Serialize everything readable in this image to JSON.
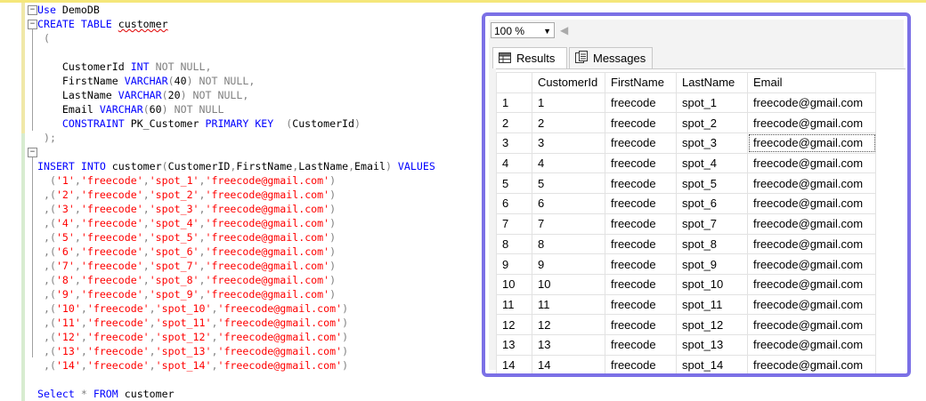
{
  "editor": {
    "lines": [
      {
        "segments": [
          {
            "t": "Use",
            "c": "kw"
          },
          {
            "t": " DemoDB",
            "c": ""
          }
        ]
      },
      {
        "segments": [
          {
            "t": "CREATE",
            "c": "kw"
          },
          {
            "t": " ",
            "c": ""
          },
          {
            "t": "TABLE",
            "c": "kw"
          },
          {
            "t": " ",
            "c": ""
          },
          {
            "t": "customer",
            "c": "squig"
          }
        ]
      },
      {
        "segments": [
          {
            "t": " (",
            "c": "gr"
          }
        ]
      },
      {
        "segments": [
          {
            "t": "",
            "c": ""
          }
        ]
      },
      {
        "segments": [
          {
            "t": "    CustomerId ",
            "c": ""
          },
          {
            "t": "INT",
            "c": "kw"
          },
          {
            "t": " ",
            "c": ""
          },
          {
            "t": "NOT NULL,",
            "c": "gr"
          }
        ]
      },
      {
        "segments": [
          {
            "t": "    FirstName ",
            "c": ""
          },
          {
            "t": "VARCHAR",
            "c": "kw"
          },
          {
            "t": "(",
            "c": "gr"
          },
          {
            "t": "40",
            "c": ""
          },
          {
            "t": ")",
            "c": "gr"
          },
          {
            "t": " ",
            "c": ""
          },
          {
            "t": "NOT NULL,",
            "c": "gr"
          }
        ]
      },
      {
        "segments": [
          {
            "t": "    LastName ",
            "c": ""
          },
          {
            "t": "VARCHAR",
            "c": "kw"
          },
          {
            "t": "(",
            "c": "gr"
          },
          {
            "t": "20",
            "c": ""
          },
          {
            "t": ")",
            "c": "gr"
          },
          {
            "t": " ",
            "c": ""
          },
          {
            "t": "NOT NULL,",
            "c": "gr"
          }
        ]
      },
      {
        "segments": [
          {
            "t": "    Email ",
            "c": ""
          },
          {
            "t": "VARCHAR",
            "c": "kw"
          },
          {
            "t": "(",
            "c": "gr"
          },
          {
            "t": "60",
            "c": ""
          },
          {
            "t": ")",
            "c": "gr"
          },
          {
            "t": " ",
            "c": ""
          },
          {
            "t": "NOT NULL",
            "c": "gr"
          }
        ]
      },
      {
        "segments": [
          {
            "t": "    ",
            "c": ""
          },
          {
            "t": "CONSTRAINT",
            "c": "kw"
          },
          {
            "t": " PK_Customer ",
            "c": ""
          },
          {
            "t": "PRIMARY KEY",
            "c": "kw"
          },
          {
            "t": "  ",
            "c": ""
          },
          {
            "t": "(",
            "c": "gr"
          },
          {
            "t": "CustomerId",
            "c": ""
          },
          {
            "t": ")",
            "c": "gr"
          }
        ]
      },
      {
        "segments": [
          {
            "t": " );",
            "c": "gr"
          }
        ]
      },
      {
        "segments": [
          {
            "t": "",
            "c": ""
          }
        ]
      },
      {
        "segments": [
          {
            "t": "INSERT",
            "c": "kw"
          },
          {
            "t": " ",
            "c": ""
          },
          {
            "t": "INTO",
            "c": "kw"
          },
          {
            "t": " customer",
            "c": ""
          },
          {
            "t": "(",
            "c": "gr"
          },
          {
            "t": "CustomerID",
            "c": ""
          },
          {
            "t": ",",
            "c": "gr"
          },
          {
            "t": "FirstName",
            "c": ""
          },
          {
            "t": ",",
            "c": "gr"
          },
          {
            "t": "LastName",
            "c": ""
          },
          {
            "t": ",",
            "c": "gr"
          },
          {
            "t": "Email",
            "c": ""
          },
          {
            "t": ")",
            "c": "gr"
          },
          {
            "t": " ",
            "c": ""
          },
          {
            "t": "VALUES",
            "c": "kw"
          }
        ]
      },
      {
        "segments": [
          {
            "t": "  (",
            "c": "gr"
          },
          {
            "t": "'1'",
            "c": "str"
          },
          {
            "t": ",",
            "c": "gr"
          },
          {
            "t": "'freecode'",
            "c": "str"
          },
          {
            "t": ",",
            "c": "gr"
          },
          {
            "t": "'spot_1'",
            "c": "str"
          },
          {
            "t": ",",
            "c": "gr"
          },
          {
            "t": "'freecode@gmail.com'",
            "c": "str"
          },
          {
            "t": ")",
            "c": "gr"
          }
        ]
      },
      {
        "segments": [
          {
            "t": " ,(",
            "c": "gr"
          },
          {
            "t": "'2'",
            "c": "str"
          },
          {
            "t": ",",
            "c": "gr"
          },
          {
            "t": "'freecode'",
            "c": "str"
          },
          {
            "t": ",",
            "c": "gr"
          },
          {
            "t": "'spot_2'",
            "c": "str"
          },
          {
            "t": ",",
            "c": "gr"
          },
          {
            "t": "'freecode@gmail.com'",
            "c": "str"
          },
          {
            "t": ")",
            "c": "gr"
          }
        ]
      },
      {
        "segments": [
          {
            "t": " ,(",
            "c": "gr"
          },
          {
            "t": "'3'",
            "c": "str"
          },
          {
            "t": ",",
            "c": "gr"
          },
          {
            "t": "'freecode'",
            "c": "str"
          },
          {
            "t": ",",
            "c": "gr"
          },
          {
            "t": "'spot_3'",
            "c": "str"
          },
          {
            "t": ",",
            "c": "gr"
          },
          {
            "t": "'freecode@gmail.com'",
            "c": "str"
          },
          {
            "t": ")",
            "c": "gr"
          }
        ]
      },
      {
        "segments": [
          {
            "t": " ,(",
            "c": "gr"
          },
          {
            "t": "'4'",
            "c": "str"
          },
          {
            "t": ",",
            "c": "gr"
          },
          {
            "t": "'freecode'",
            "c": "str"
          },
          {
            "t": ",",
            "c": "gr"
          },
          {
            "t": "'spot_4'",
            "c": "str"
          },
          {
            "t": ",",
            "c": "gr"
          },
          {
            "t": "'freecode@gmail.com'",
            "c": "str"
          },
          {
            "t": ")",
            "c": "gr"
          }
        ]
      },
      {
        "segments": [
          {
            "t": " ,(",
            "c": "gr"
          },
          {
            "t": "'5'",
            "c": "str"
          },
          {
            "t": ",",
            "c": "gr"
          },
          {
            "t": "'freecode'",
            "c": "str"
          },
          {
            "t": ",",
            "c": "gr"
          },
          {
            "t": "'spot_5'",
            "c": "str"
          },
          {
            "t": ",",
            "c": "gr"
          },
          {
            "t": "'freecode@gmail.com'",
            "c": "str"
          },
          {
            "t": ")",
            "c": "gr"
          }
        ]
      },
      {
        "segments": [
          {
            "t": " ,(",
            "c": "gr"
          },
          {
            "t": "'6'",
            "c": "str"
          },
          {
            "t": ",",
            "c": "gr"
          },
          {
            "t": "'freecode'",
            "c": "str"
          },
          {
            "t": ",",
            "c": "gr"
          },
          {
            "t": "'spot_6'",
            "c": "str"
          },
          {
            "t": ",",
            "c": "gr"
          },
          {
            "t": "'freecode@gmail.com'",
            "c": "str"
          },
          {
            "t": ")",
            "c": "gr"
          }
        ]
      },
      {
        "segments": [
          {
            "t": " ,(",
            "c": "gr"
          },
          {
            "t": "'7'",
            "c": "str"
          },
          {
            "t": ",",
            "c": "gr"
          },
          {
            "t": "'freecode'",
            "c": "str"
          },
          {
            "t": ",",
            "c": "gr"
          },
          {
            "t": "'spot_7'",
            "c": "str"
          },
          {
            "t": ",",
            "c": "gr"
          },
          {
            "t": "'freecode@gmail.com'",
            "c": "str"
          },
          {
            "t": ")",
            "c": "gr"
          }
        ]
      },
      {
        "segments": [
          {
            "t": " ,(",
            "c": "gr"
          },
          {
            "t": "'8'",
            "c": "str"
          },
          {
            "t": ",",
            "c": "gr"
          },
          {
            "t": "'freecode'",
            "c": "str"
          },
          {
            "t": ",",
            "c": "gr"
          },
          {
            "t": "'spot_8'",
            "c": "str"
          },
          {
            "t": ",",
            "c": "gr"
          },
          {
            "t": "'freecode@gmail.com'",
            "c": "str"
          },
          {
            "t": ")",
            "c": "gr"
          }
        ]
      },
      {
        "segments": [
          {
            "t": " ,(",
            "c": "gr"
          },
          {
            "t": "'9'",
            "c": "str"
          },
          {
            "t": ",",
            "c": "gr"
          },
          {
            "t": "'freecode'",
            "c": "str"
          },
          {
            "t": ",",
            "c": "gr"
          },
          {
            "t": "'spot_9'",
            "c": "str"
          },
          {
            "t": ",",
            "c": "gr"
          },
          {
            "t": "'freecode@gmail.com'",
            "c": "str"
          },
          {
            "t": ")",
            "c": "gr"
          }
        ]
      },
      {
        "segments": [
          {
            "t": " ,(",
            "c": "gr"
          },
          {
            "t": "'10'",
            "c": "str"
          },
          {
            "t": ",",
            "c": "gr"
          },
          {
            "t": "'freecode'",
            "c": "str"
          },
          {
            "t": ",",
            "c": "gr"
          },
          {
            "t": "'spot_10'",
            "c": "str"
          },
          {
            "t": ",",
            "c": "gr"
          },
          {
            "t": "'freecode@gmail.com'",
            "c": "str"
          },
          {
            "t": ")",
            "c": "gr"
          }
        ]
      },
      {
        "segments": [
          {
            "t": " ,(",
            "c": "gr"
          },
          {
            "t": "'11'",
            "c": "str"
          },
          {
            "t": ",",
            "c": "gr"
          },
          {
            "t": "'freecode'",
            "c": "str"
          },
          {
            "t": ",",
            "c": "gr"
          },
          {
            "t": "'spot_11'",
            "c": "str"
          },
          {
            "t": ",",
            "c": "gr"
          },
          {
            "t": "'freecode@gmail.com'",
            "c": "str"
          },
          {
            "t": ")",
            "c": "gr"
          }
        ]
      },
      {
        "segments": [
          {
            "t": " ,(",
            "c": "gr"
          },
          {
            "t": "'12'",
            "c": "str"
          },
          {
            "t": ",",
            "c": "gr"
          },
          {
            "t": "'freecode'",
            "c": "str"
          },
          {
            "t": ",",
            "c": "gr"
          },
          {
            "t": "'spot_12'",
            "c": "str"
          },
          {
            "t": ",",
            "c": "gr"
          },
          {
            "t": "'freecode@gmail.com'",
            "c": "str"
          },
          {
            "t": ")",
            "c": "gr"
          }
        ]
      },
      {
        "segments": [
          {
            "t": " ,(",
            "c": "gr"
          },
          {
            "t": "'13'",
            "c": "str"
          },
          {
            "t": ",",
            "c": "gr"
          },
          {
            "t": "'freecode'",
            "c": "str"
          },
          {
            "t": ",",
            "c": "gr"
          },
          {
            "t": "'spot_13'",
            "c": "str"
          },
          {
            "t": ",",
            "c": "gr"
          },
          {
            "t": "'freecode@gmail.com'",
            "c": "str"
          },
          {
            "t": ")",
            "c": "gr"
          }
        ]
      },
      {
        "segments": [
          {
            "t": " ,(",
            "c": "gr"
          },
          {
            "t": "'14'",
            "c": "str"
          },
          {
            "t": ",",
            "c": "gr"
          },
          {
            "t": "'freecode'",
            "c": "str"
          },
          {
            "t": ",",
            "c": "gr"
          },
          {
            "t": "'spot_14'",
            "c": "str"
          },
          {
            "t": ",",
            "c": "gr"
          },
          {
            "t": "'freecode@gmail.com'",
            "c": "str"
          },
          {
            "t": ")",
            "c": "gr"
          }
        ]
      },
      {
        "segments": [
          {
            "t": "",
            "c": ""
          }
        ]
      },
      {
        "segments": [
          {
            "t": "Select",
            "c": "kw"
          },
          {
            "t": " ",
            "c": ""
          },
          {
            "t": "*",
            "c": "gr"
          },
          {
            "t": " ",
            "c": ""
          },
          {
            "t": "FROM",
            "c": "kw"
          },
          {
            "t": " customer",
            "c": ""
          }
        ]
      }
    ]
  },
  "results_panel": {
    "zoom": "100 %",
    "tabs": [
      {
        "label": "Results",
        "icon": "grid-icon"
      },
      {
        "label": "Messages",
        "icon": "messages-icon"
      }
    ],
    "columns": [
      "",
      "CustomerId",
      "FirstName",
      "LastName",
      "Email"
    ],
    "rows": [
      [
        "1",
        "1",
        "freecode",
        "spot_1",
        "freecode@gmail.com"
      ],
      [
        "2",
        "2",
        "freecode",
        "spot_2",
        "freecode@gmail.com"
      ],
      [
        "3",
        "3",
        "freecode",
        "spot_3",
        "freecode@gmail.com"
      ],
      [
        "4",
        "4",
        "freecode",
        "spot_4",
        "freecode@gmail.com"
      ],
      [
        "5",
        "5",
        "freecode",
        "spot_5",
        "freecode@gmail.com"
      ],
      [
        "6",
        "6",
        "freecode",
        "spot_6",
        "freecode@gmail.com"
      ],
      [
        "7",
        "7",
        "freecode",
        "spot_7",
        "freecode@gmail.com"
      ],
      [
        "8",
        "8",
        "freecode",
        "spot_8",
        "freecode@gmail.com"
      ],
      [
        "9",
        "9",
        "freecode",
        "spot_9",
        "freecode@gmail.com"
      ],
      [
        "10",
        "10",
        "freecode",
        "spot_10",
        "freecode@gmail.com"
      ],
      [
        "11",
        "11",
        "freecode",
        "spot_11",
        "freecode@gmail.com"
      ],
      [
        "12",
        "12",
        "freecode",
        "spot_12",
        "freecode@gmail.com"
      ],
      [
        "13",
        "13",
        "freecode",
        "spot_13",
        "freecode@gmail.com"
      ],
      [
        "14",
        "14",
        "freecode",
        "spot_14",
        "freecode@gmail.com"
      ]
    ]
  }
}
